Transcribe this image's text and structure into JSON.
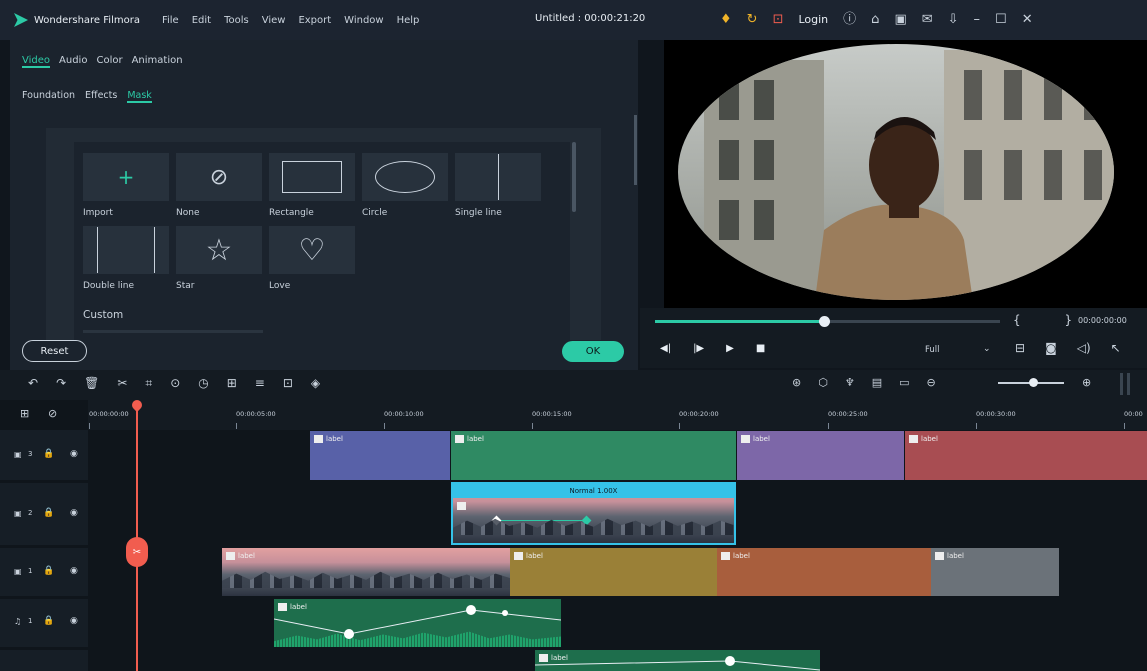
{
  "app": {
    "name": "Wondershare Filmora",
    "doc_title": "Untitled : 00:00:21:20",
    "login": "Login"
  },
  "menu": [
    "File",
    "Edit",
    "Tools",
    "View",
    "Export",
    "Window",
    "Help"
  ],
  "top_icons": [
    "bulb-icon",
    "sync-icon",
    "cart-icon",
    "login",
    "info-icon",
    "gift-icon",
    "save-icon",
    "mail-icon",
    "download-icon",
    "minimize-icon",
    "maximize-icon",
    "close-icon"
  ],
  "panel": {
    "tabs": [
      "Video",
      "Audio",
      "Color",
      "Animation"
    ],
    "subtabs": [
      "Foundation",
      "Effects",
      "Mask"
    ],
    "masks": [
      {
        "label": "Import",
        "icon": "plus-icon"
      },
      {
        "label": "None",
        "icon": "none-icon"
      },
      {
        "label": "Rectangle",
        "icon": "rectangle-icon"
      },
      {
        "label": "Circle",
        "icon": "ellipse-icon"
      },
      {
        "label": "Single line",
        "icon": "single-line-icon"
      },
      {
        "label": "Double line",
        "icon": "double-line-icon"
      },
      {
        "label": "Star",
        "icon": "star-icon"
      },
      {
        "label": "Love",
        "icon": "heart-icon"
      }
    ],
    "custom_label": "Custom",
    "reset": "Reset",
    "ok": "OK"
  },
  "player": {
    "timecode": "00:00:00:00",
    "quality": "Full",
    "progress": 0.49,
    "brackets": "{ }"
  },
  "ruler": [
    "00:00:00:00",
    "00:00:05:00",
    "00:00:10:00",
    "00:00:15:00",
    "00:00:20:00",
    "00:00:25:00",
    "00:00:30:00",
    "00:00"
  ],
  "tracks": {
    "t3": "3",
    "t2": "2",
    "t1": "1",
    "a1": "1"
  },
  "clip_label": "label",
  "speed_label": "Normal 1.00X",
  "colors": {
    "accent": "#2ccaa6",
    "blue": "#5861a8",
    "green": "#2f8a63",
    "purple": "#7d67a8",
    "red": "#a84d52",
    "gold": "#9a8037",
    "orange": "#a85e3d",
    "gray": "#6b7279",
    "playhead": "#f15d4f"
  }
}
